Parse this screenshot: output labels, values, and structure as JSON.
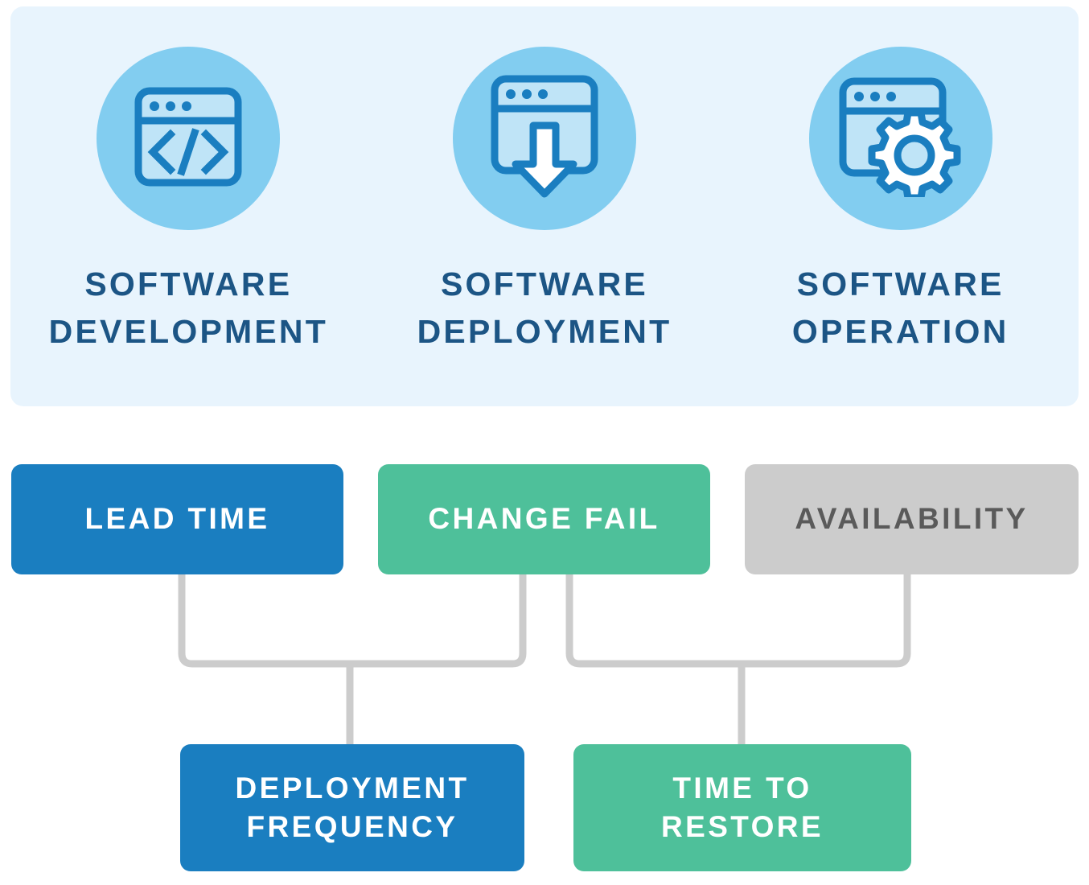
{
  "stages": {
    "panel_name": "software-lifecycle-stages",
    "items": [
      {
        "icon": "code-window-icon",
        "label": "SOFTWARE\nDEVELOPMENT"
      },
      {
        "icon": "download-window-icon",
        "label": "SOFTWARE\nDEPLOYMENT"
      },
      {
        "icon": "gear-window-icon",
        "label": "SOFTWARE\nOPERATION"
      }
    ]
  },
  "metrics": {
    "top_row": [
      {
        "id": "lead-time",
        "label": "LEAD TIME",
        "color": "#1a7ec0"
      },
      {
        "id": "change-fail",
        "label": "CHANGE FAIL",
        "color": "#4ec09a"
      },
      {
        "id": "availability",
        "label": "AVAILABILITY",
        "color": "#cccccc"
      }
    ],
    "bottom_row": [
      {
        "id": "deployment-frequency",
        "label": "DEPLOYMENT\nFREQUENCY",
        "color": "#1a7ec0"
      },
      {
        "id": "time-to-restore",
        "label": "TIME TO\nRESTORE",
        "color": "#4ec09a"
      }
    ]
  },
  "colors": {
    "panel_background": "#e8f4fd",
    "circle": "#82cdf0",
    "icon_stroke": "#1a7ec0",
    "icon_fill": "#bfe4f7",
    "heading_text": "#1c5585",
    "connector": "#cccccc",
    "page_background": "#ffffff"
  },
  "connectors": {
    "left_group": {
      "sources": [
        "lead-time",
        "change-fail"
      ],
      "target": "deployment-frequency"
    },
    "right_group": {
      "sources": [
        "change-fail",
        "availability"
      ],
      "target": "time-to-restore"
    }
  }
}
